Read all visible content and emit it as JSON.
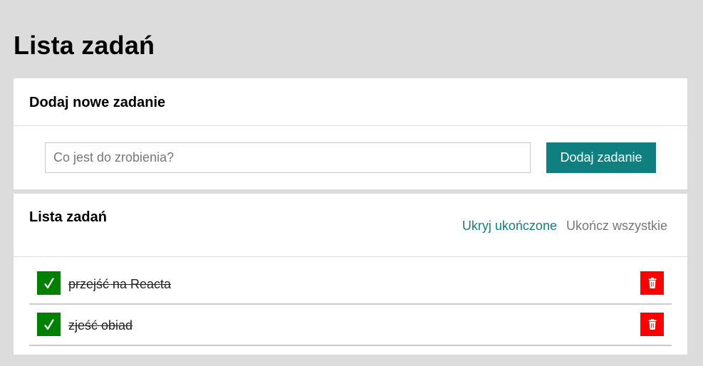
{
  "page": {
    "title": "Lista zadań"
  },
  "add_section": {
    "title": "Dodaj nowe zadanie",
    "input": {
      "value": "",
      "placeholder": "Co jest do zrobienia?"
    },
    "button_label": "Dodaj zadanie"
  },
  "list_section": {
    "title": "Lista zadań",
    "hide_done_label": "Ukryj ukończone",
    "complete_all_label": "Ukończ wszystkie",
    "tasks": [
      {
        "text": "przejść na Reacta",
        "done": true,
        "toggle_icon": "check-icon",
        "delete_icon": "trash-icon"
      },
      {
        "text": "zjeść obiad",
        "done": true,
        "toggle_icon": "check-icon",
        "delete_icon": "trash-icon"
      }
    ]
  },
  "colors": {
    "background": "#dcdcdc",
    "accent": "#0f7f7f",
    "done": "#008000",
    "delete": "#ff0000"
  }
}
